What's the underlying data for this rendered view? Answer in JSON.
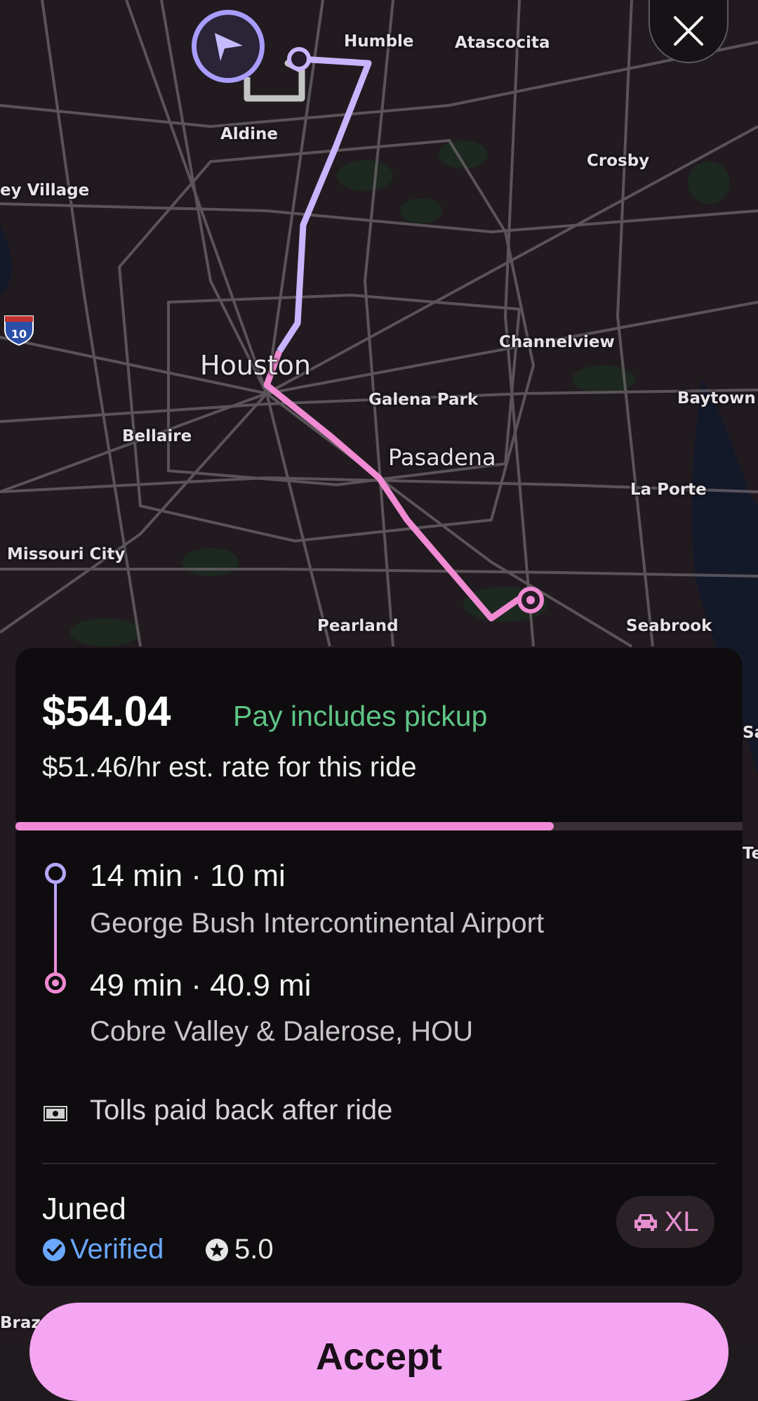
{
  "map": {
    "places": {
      "humble": "Humble",
      "atascocita": "Atascocita",
      "aldine": "Aldine",
      "crosby": "Crosby",
      "ey_village": "ey Village",
      "houston": "Houston",
      "channelview": "Channelview",
      "galena_park": "Galena Park",
      "baytown": "Baytown",
      "bellaire": "Bellaire",
      "pasadena": "Pasadena",
      "la_porte": "La Porte",
      "missouri_city": "Missouri City",
      "pearland": "Pearland",
      "seabrook": "Seabrook",
      "sa": "Sa",
      "te": "Te",
      "brazo": "Brazo"
    },
    "interstate_shield": "10",
    "route_colors": {
      "pickup_leg": "#c9b4ff",
      "trip_leg": "#f08ad2",
      "driver_leg": "#bdbdbd"
    }
  },
  "ride": {
    "fare": "$54.04",
    "fare_note": "Pay includes pickup",
    "rate": "$51.46/hr est. rate for this ride",
    "timer_progress_pct": 74,
    "pickup": {
      "time_distance": "14 min · 10 mi",
      "address": "George Bush Intercontinental Airport"
    },
    "dropoff": {
      "time_distance": "49 min · 40.9 mi",
      "address": "Cobre Valley & Dalerose, HOU"
    },
    "tolls": "Tolls paid back after ride",
    "rider": {
      "name": "Juned",
      "verified": "Verified",
      "rating": "5.0"
    },
    "ride_type": "XL"
  },
  "actions": {
    "accept": "Accept"
  },
  "icons": {
    "close": "close-icon",
    "navigation": "navigation-arrow-icon",
    "tolls": "cash-icon",
    "verified": "check-circle-icon",
    "rating": "star-icon",
    "car": "car-icon"
  },
  "colors": {
    "accent_pink": "#f08ad2",
    "accent_purple": "#a99cff",
    "green_note": "#5ec486",
    "verified_blue": "#6aa8ff"
  }
}
